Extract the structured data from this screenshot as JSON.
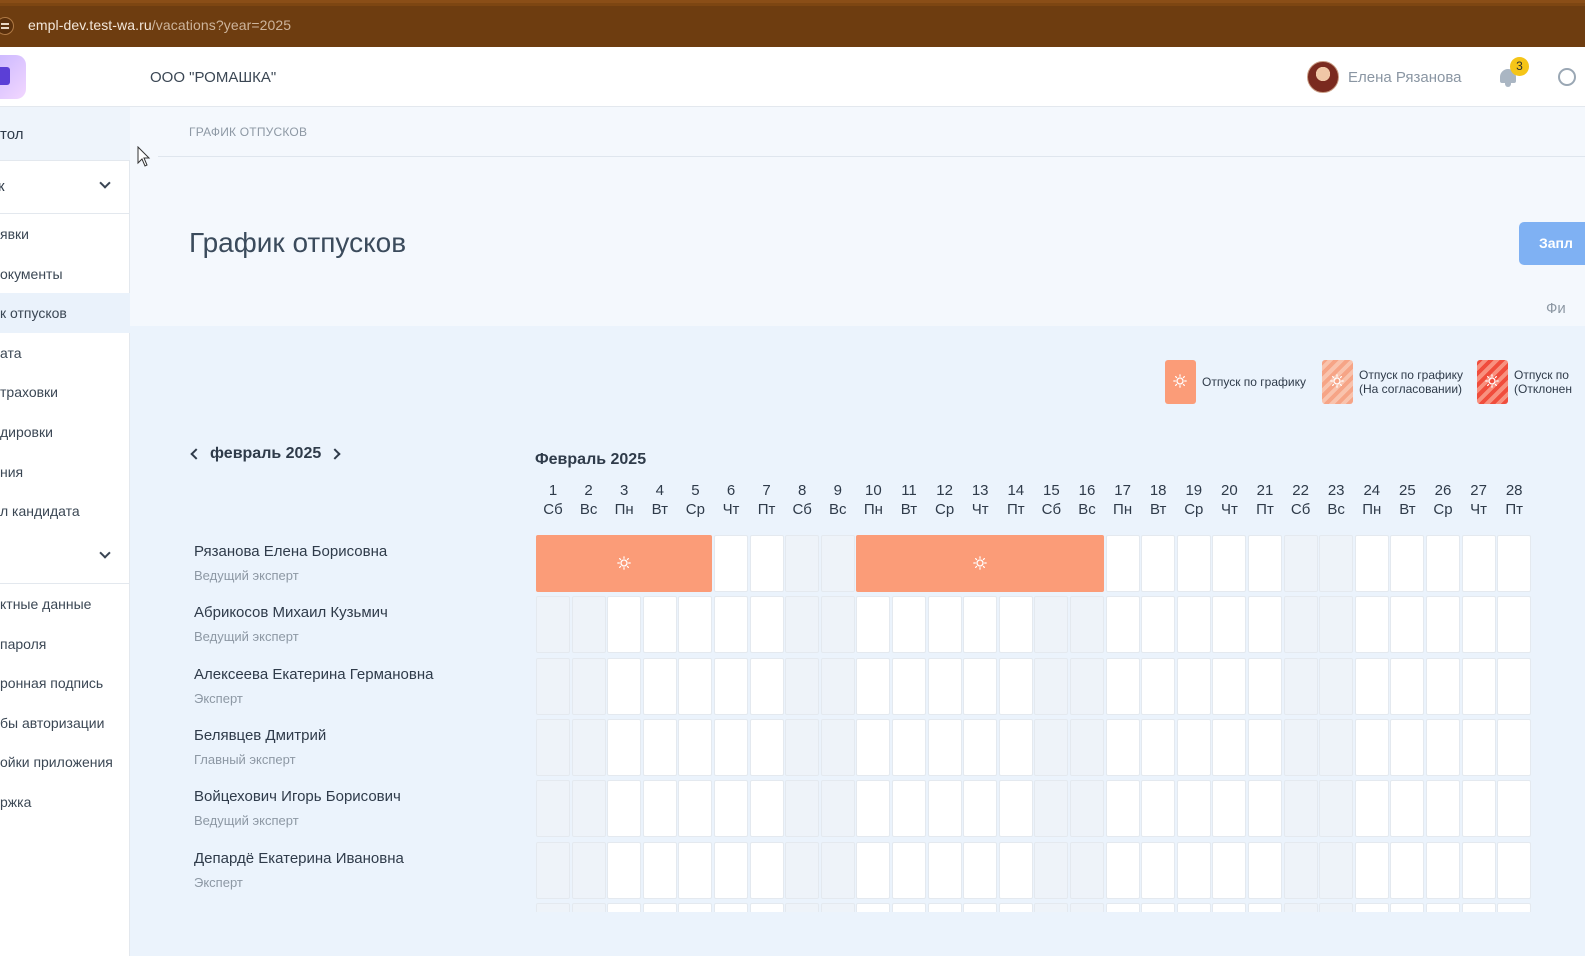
{
  "browser": {
    "url_host": "empl-dev.test-wa.ru",
    "url_path": "/vacations?year=2025"
  },
  "header": {
    "company": "ООО \"РОМАШКА\"",
    "user_name": "Елена Рязанова",
    "notifications_count": "3"
  },
  "sidebar": {
    "top_item": "тол",
    "group1": "к",
    "items1": [
      "явки",
      "окументы",
      "к отпусков",
      "ата",
      "траховки",
      "дировки",
      "ния",
      "л кандидата"
    ],
    "active_index": 2,
    "items2": [
      "ктные данные",
      " пароля",
      "ронная подпись",
      "бы авторизации",
      "ойки приложения",
      "ржка"
    ]
  },
  "main": {
    "breadcrumb": "ГРАФИК ОТПУСКОВ",
    "title": "График отпусков",
    "apply_button": "Запл",
    "filter_label": "Фи"
  },
  "legend": [
    {
      "label_line1": "Отпуск по графику",
      "label_line2": "",
      "style": "solid"
    },
    {
      "label_line1": "Отпуск по графику",
      "label_line2": "(На согласовании)",
      "style": "pending"
    },
    {
      "label_line1": "Отпуск по",
      "label_line2": "(Отклонен",
      "style": "rejected"
    }
  ],
  "calendar": {
    "nav_month": "февраль 2025",
    "title": "Февраль 2025",
    "days": [
      {
        "d": "1",
        "w": "Сб",
        "we": true
      },
      {
        "d": "2",
        "w": "Вс",
        "we": true
      },
      {
        "d": "3",
        "w": "Пн",
        "we": false
      },
      {
        "d": "4",
        "w": "Вт",
        "we": false
      },
      {
        "d": "5",
        "w": "Ср",
        "we": false
      },
      {
        "d": "6",
        "w": "Чт",
        "we": false
      },
      {
        "d": "7",
        "w": "Пт",
        "we": false
      },
      {
        "d": "8",
        "w": "Сб",
        "we": true
      },
      {
        "d": "9",
        "w": "Вс",
        "we": true
      },
      {
        "d": "10",
        "w": "Пн",
        "we": false
      },
      {
        "d": "11",
        "w": "Вт",
        "we": false
      },
      {
        "d": "12",
        "w": "Ср",
        "we": false
      },
      {
        "d": "13",
        "w": "Чт",
        "we": false
      },
      {
        "d": "14",
        "w": "Пт",
        "we": false
      },
      {
        "d": "15",
        "w": "Сб",
        "we": true
      },
      {
        "d": "16",
        "w": "Вс",
        "we": true
      },
      {
        "d": "17",
        "w": "Пн",
        "we": false
      },
      {
        "d": "18",
        "w": "Вт",
        "we": false
      },
      {
        "d": "19",
        "w": "Ср",
        "we": false
      },
      {
        "d": "20",
        "w": "Чт",
        "we": false
      },
      {
        "d": "21",
        "w": "Пт",
        "we": false
      },
      {
        "d": "22",
        "w": "Сб",
        "we": true
      },
      {
        "d": "23",
        "w": "Вс",
        "we": true
      },
      {
        "d": "24",
        "w": "Пн",
        "we": false
      },
      {
        "d": "25",
        "w": "Вт",
        "we": false
      },
      {
        "d": "26",
        "w": "Ср",
        "we": false
      },
      {
        "d": "27",
        "w": "Чт",
        "we": false
      },
      {
        "d": "28",
        "w": "Пт",
        "we": false
      }
    ],
    "employees": [
      {
        "name": "Рязанова Елена Борисовна",
        "position": "Ведущий эксперт",
        "vacations": [
          [
            1,
            5
          ],
          [
            10,
            16
          ]
        ]
      },
      {
        "name": "Абрикосов Михаил Кузьмич",
        "position": "Ведущий эксперт",
        "vacations": []
      },
      {
        "name": "Алексеева Екатерина Германовна",
        "position": "Эксперт",
        "vacations": []
      },
      {
        "name": "Белявцев Дмитрий",
        "position": "Главный эксперт",
        "vacations": []
      },
      {
        "name": "Войцехович Игорь Борисович",
        "position": "Ведущий эксперт",
        "vacations": []
      },
      {
        "name": "Депардё Екатерина Ивановна",
        "position": "Эксперт",
        "vacations": []
      }
    ]
  },
  "colors": {
    "vacation": "#fb9c78",
    "header_bg": "#6e3d10",
    "accent_button": "#7fb1f3"
  }
}
